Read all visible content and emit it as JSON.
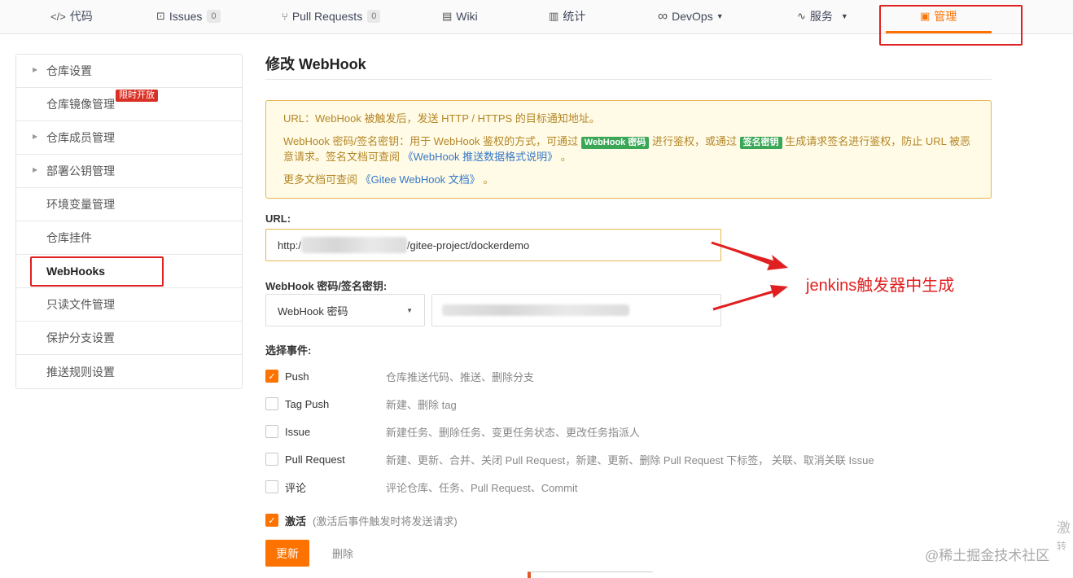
{
  "topnav": {
    "items": [
      {
        "label": "代码",
        "icon": "code-icon",
        "glyph": "</>"
      },
      {
        "label": "Issues",
        "icon": "issues-icon",
        "glyph": "⊡",
        "count": "0"
      },
      {
        "label": "Pull Requests",
        "icon": "pull-request-icon",
        "glyph": "⑂",
        "count": "0"
      },
      {
        "label": "Wiki",
        "icon": "wiki-icon",
        "glyph": "▤"
      },
      {
        "label": "统计",
        "icon": "stats-icon",
        "glyph": "▥"
      },
      {
        "label": "DevOps",
        "icon": "infinity-icon",
        "glyph": "∞"
      },
      {
        "label": "服务",
        "icon": "pulse-icon",
        "glyph": "∿"
      },
      {
        "label": "管理",
        "icon": "manage-icon",
        "glyph": "▣"
      }
    ],
    "accent": "#fe7300"
  },
  "sidebar": {
    "items": [
      {
        "label": "仓库设置"
      },
      {
        "label": "仓库镜像管理",
        "badge": "限时开放"
      },
      {
        "label": "仓库成员管理"
      },
      {
        "label": "部署公钥管理"
      },
      {
        "label": "环境变量管理"
      },
      {
        "label": "仓库挂件"
      },
      {
        "label": "WebHooks"
      },
      {
        "label": "只读文件管理"
      },
      {
        "label": "保护分支设置"
      },
      {
        "label": "推送规则设置"
      }
    ]
  },
  "main": {
    "title": "修改 WebHook",
    "notice": {
      "line1": "URL：WebHook 被触发后，发送 HTTP / HTTPS 的目标通知地址。",
      "line2_a": "WebHook 密码/签名密钥：用于 WebHook 鉴权的方式，可通过",
      "tag1": "WebHook 密码",
      "line2_b": "进行鉴权，或通过",
      "tag2": "签名密钥",
      "line2_c": "生成请求签名进行鉴权，防止 URL 被恶意请求。签名文档可查阅",
      "link1": "《WebHook 推送数据格式说明》",
      "line2_d": "。",
      "line3_a": "更多文档可查阅",
      "link2": "《Gitee WebHook 文档》",
      "line3_b": "。"
    },
    "url_label": "URL:",
    "url_prefix": "http:/",
    "url_suffix": "/gitee-project/dockerdemo",
    "secret_label": "WebHook 密码/签名密钥:",
    "secret_type": "WebHook 密码",
    "events_label": "选择事件:",
    "events": [
      {
        "name": "Push",
        "desc": "仓库推送代码、推送、删除分支",
        "checked": true
      },
      {
        "name": "Tag Push",
        "desc": "新建、删除 tag",
        "checked": false
      },
      {
        "name": "Issue",
        "desc": "新建任务、删除任务、变更任务状态、更改任务指派人",
        "checked": false
      },
      {
        "name": "Pull Request",
        "desc": "新建、更新、合并、关闭 Pull Request，新建、更新、删除 Pull Request 下标签， 关联、取消关联 Issue",
        "checked": false
      },
      {
        "name": "评论",
        "desc": "评论仓库、任务、Pull Request、Commit",
        "checked": false
      }
    ],
    "activate_label": "激活",
    "activate_hint": "(激活后事件触发时将发送请求)",
    "activate_checked": true,
    "update_button": "更新",
    "delete_button": "删除"
  },
  "annotation": {
    "text": "jenkins触发器中生成",
    "color": "#e02020"
  },
  "watermark": {
    "text": "@稀土掘金技术社区",
    "side1": "激",
    "side2": "转"
  }
}
